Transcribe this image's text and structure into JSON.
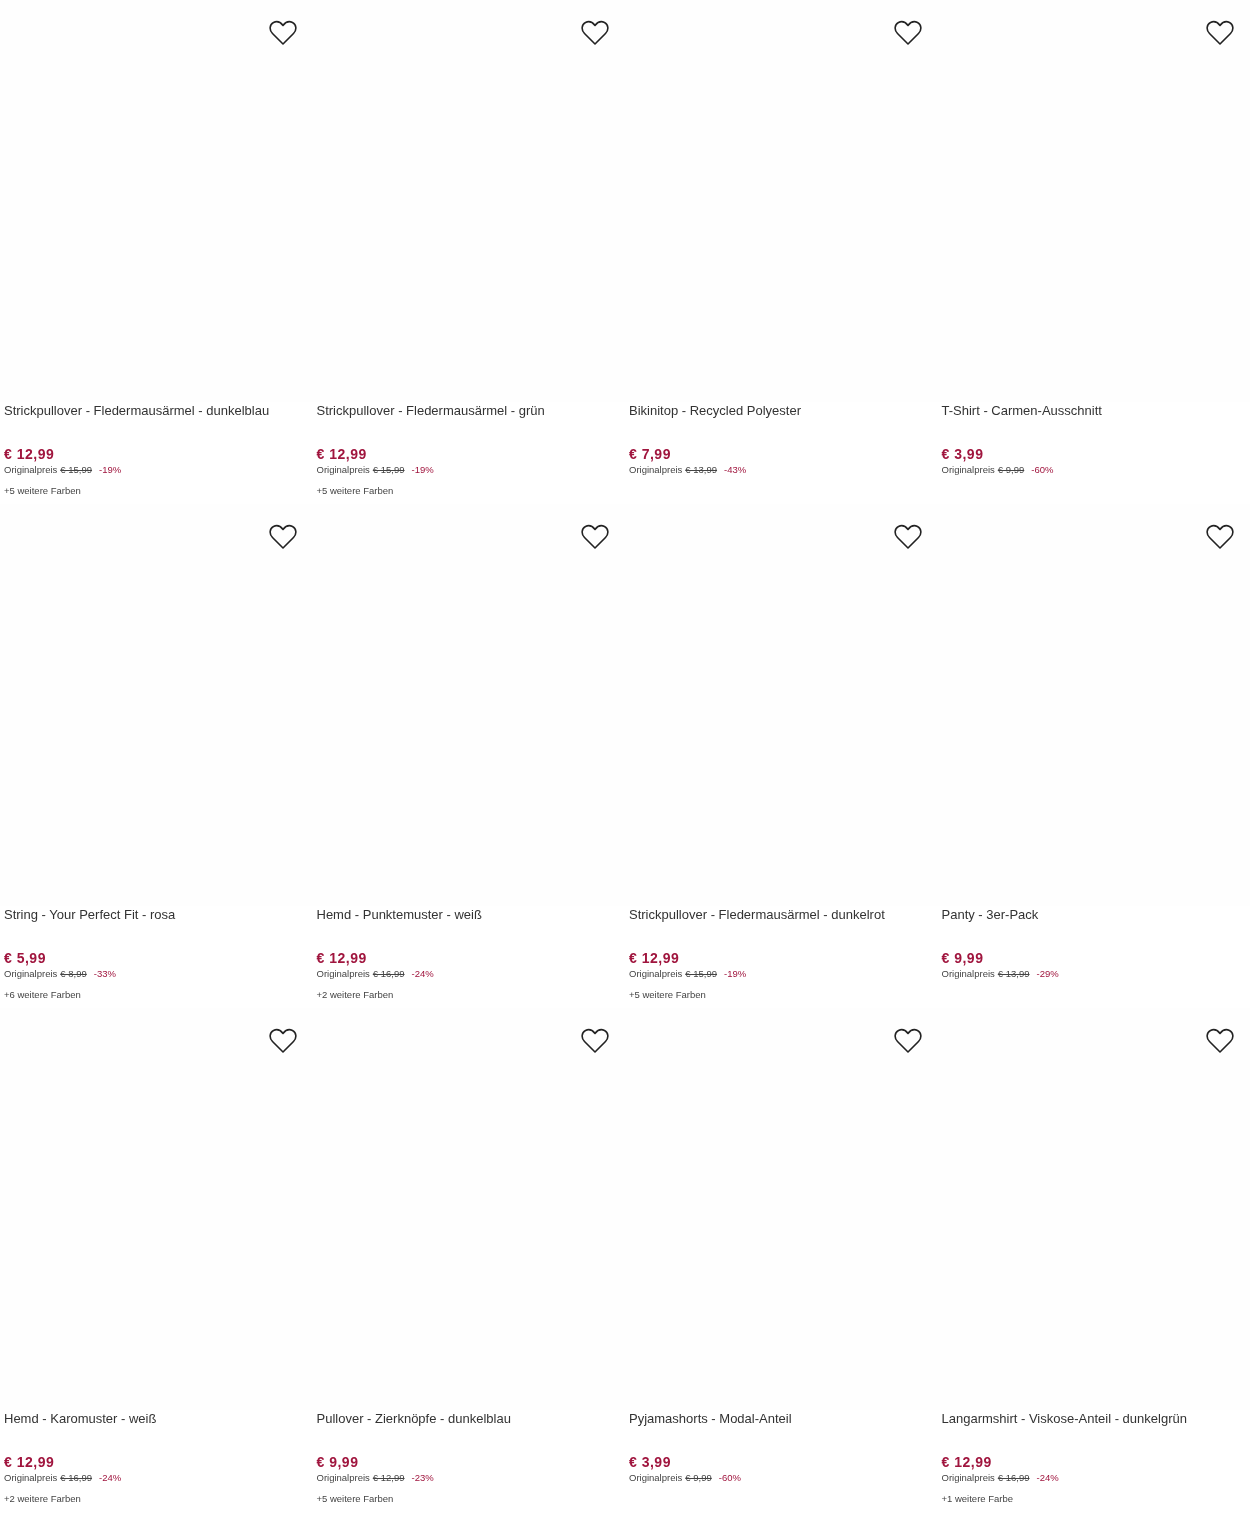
{
  "products": [
    {
      "name": "Strickpullover - Fledermausärmel - dunkelblau",
      "price": "€ 12,99",
      "original_label": "Originalpreis",
      "old_price": "€ 15,99",
      "discount": "-19%",
      "more_colors": "+5 weitere Farben",
      "favorite": false
    },
    {
      "name": "Strickpullover - Fledermausärmel - grün",
      "price": "€ 12,99",
      "original_label": "Originalpreis",
      "old_price": "€ 15,99",
      "discount": "-19%",
      "more_colors": "+5 weitere Farben",
      "favorite": false
    },
    {
      "name": "Bikinitop - Recycled Polyester",
      "price": "€ 7,99",
      "original_label": "Originalpreis",
      "old_price": "€ 13,99",
      "discount": "-43%",
      "favorite": false
    },
    {
      "name": "T-Shirt - Carmen-Ausschnitt",
      "price": "€ 3,99",
      "original_label": "Originalpreis",
      "old_price": "€ 9,99",
      "discount": "-60%",
      "favorite": false
    },
    {
      "name": "String - Your Perfect Fit - rosa",
      "price": "€ 5,99",
      "original_label": "Originalpreis",
      "old_price": "€ 8,99",
      "discount": "-33%",
      "more_colors": "+6 weitere Farben",
      "favorite": false
    },
    {
      "name": "Hemd - Punktemuster - weiß",
      "price": "€ 12,99",
      "original_label": "Originalpreis",
      "old_price": "€ 16,99",
      "discount": "-24%",
      "more_colors": "+2 weitere Farben",
      "favorite": false
    },
    {
      "name": "Strickpullover - Fledermausärmel - dunkelrot",
      "price": "€ 12,99",
      "original_label": "Originalpreis",
      "old_price": "€ 15,99",
      "discount": "-19%",
      "more_colors": "+5 weitere Farben",
      "favorite": false
    },
    {
      "name": "Panty - 3er-Pack",
      "price": "€ 9,99",
      "original_label": "Originalpreis",
      "old_price": "€ 13,99",
      "discount": "-29%",
      "favorite": false
    },
    {
      "name": "Hemd - Karomuster - weiß",
      "price": "€ 12,99",
      "original_label": "Originalpreis",
      "old_price": "€ 16,99",
      "discount": "-24%",
      "more_colors": "+2 weitere Farben",
      "favorite": false
    },
    {
      "name": "Pullover - Zierknöpfe - dunkelblau",
      "price": "€ 9,99",
      "original_label": "Originalpreis",
      "old_price": "€ 12,99",
      "discount": "-23%",
      "more_colors": "+5 weitere Farben",
      "favorite": false
    },
    {
      "name": "Pyjamashorts - Modal-Anteil",
      "price": "€ 3,99",
      "original_label": "Originalpreis",
      "old_price": "€ 9,99",
      "discount": "-60%",
      "favorite": false
    },
    {
      "name": "Langarmshirt - Viskose-Anteil - dunkelgrün",
      "price": "€ 12,99",
      "original_label": "Originalpreis",
      "old_price": "€ 16,99",
      "discount": "-24%",
      "more_colors": "+1 weitere Farbe",
      "favorite": false
    }
  ]
}
